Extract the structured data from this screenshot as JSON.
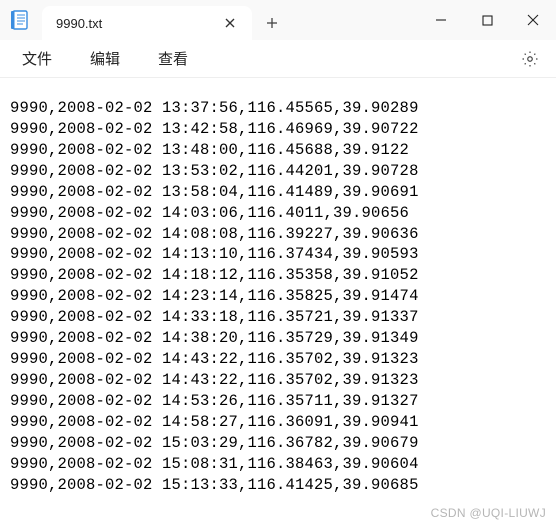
{
  "titlebar": {
    "tab_title": "9990.txt"
  },
  "menubar": {
    "file": "文件",
    "edit": "编辑",
    "view": "查看"
  },
  "lines": [
    "9990,2008-02-02 13:37:56,116.45565,39.90289",
    "9990,2008-02-02 13:42:58,116.46969,39.90722",
    "9990,2008-02-02 13:48:00,116.45688,39.9122",
    "9990,2008-02-02 13:53:02,116.44201,39.90728",
    "9990,2008-02-02 13:58:04,116.41489,39.90691",
    "9990,2008-02-02 14:03:06,116.4011,39.90656",
    "9990,2008-02-02 14:08:08,116.39227,39.90636",
    "9990,2008-02-02 14:13:10,116.37434,39.90593",
    "9990,2008-02-02 14:18:12,116.35358,39.91052",
    "9990,2008-02-02 14:23:14,116.35825,39.91474",
    "9990,2008-02-02 14:33:18,116.35721,39.91337",
    "9990,2008-02-02 14:38:20,116.35729,39.91349",
    "9990,2008-02-02 14:43:22,116.35702,39.91323",
    "9990,2008-02-02 14:43:22,116.35702,39.91323",
    "9990,2008-02-02 14:53:26,116.35711,39.91327",
    "9990,2008-02-02 14:58:27,116.36091,39.90941",
    "9990,2008-02-02 15:03:29,116.36782,39.90679",
    "9990,2008-02-02 15:08:31,116.38463,39.90604",
    "9990,2008-02-02 15:13:33,116.41425,39.90685"
  ],
  "watermark": "CSDN @UQI-LIUWJ"
}
